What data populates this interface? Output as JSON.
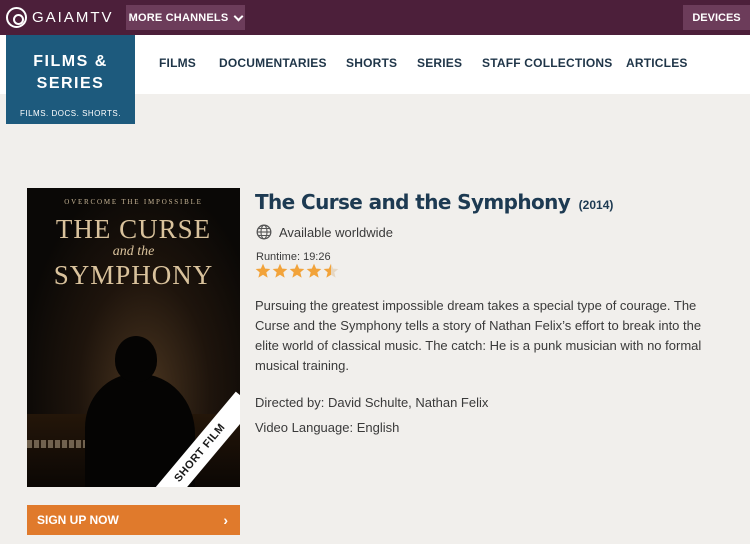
{
  "topbar": {
    "logo_text": "GAIAMTV",
    "more_channels_label": "MORE CHANNELS",
    "devices_label": "DEVICES"
  },
  "brand": {
    "title_line1": "FILMS &",
    "title_line2": "SERIES",
    "subtitle": "FILMS. DOCS. SHORTS."
  },
  "nav": {
    "items": [
      "FILMS",
      "DOCUMENTARIES",
      "SHORTS",
      "SERIES",
      "STAFF COLLECTIONS",
      "ARTICLES"
    ]
  },
  "poster": {
    "tagline": "OVERCOME THE IMPOSSIBLE",
    "title_line1": "THE CURSE",
    "title_line2": "and the",
    "title_line3": "SYMPHONY",
    "ribbon": "SHORT FILM"
  },
  "signup": {
    "label": "SIGN UP NOW",
    "arrow": "›"
  },
  "details": {
    "title": "The Curse and the Symphony",
    "year": "(2014)",
    "availability": "Available worldwide",
    "runtime": "Runtime: 19:26",
    "rating": 4.5,
    "rating_max": 5,
    "description": "Pursuing the greatest impossible dream takes a special type of courage. The Curse and the Symphony tells a story of Nathan Felix’s effort to break into the elite world of classical music. The catch: He is a punk musician with no formal musical training.",
    "directed_by": "Directed by: David Schulte, Nathan Felix",
    "language": "Video Language: English"
  },
  "colors": {
    "topbar": "#4c1f3a",
    "topbar_button": "#6c3c5a",
    "brand_box": "#1d5a7d",
    "title": "#1d3a52",
    "star": "#f2a33a",
    "signup": "#e07a2c"
  },
  "icons": {
    "logo": "gaiam-logo-icon",
    "dropdown": "chevron-down-icon",
    "globe": "globe-icon",
    "star": "star-icon",
    "arrow": "chevron-right-icon"
  }
}
